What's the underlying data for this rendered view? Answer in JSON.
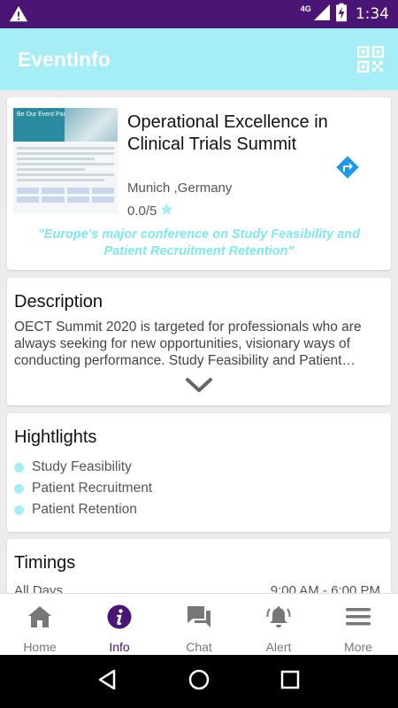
{
  "status_bar": {
    "network": "4G",
    "time": "1:34",
    "icons": [
      "warning-icon",
      "signal-icon",
      "battery-charging-icon"
    ]
  },
  "app_bar": {
    "title": "EventInfo",
    "icon": "qr-code-icon"
  },
  "event": {
    "title": "Operational Excellence in Clinical Trials Summit",
    "location": "Munich ,Germany",
    "rating": "0.0/5",
    "rating_icon": "star-icon",
    "directions_icon": "directions-icon",
    "tagline": "\"Europe's major conference on Study Feasibility and Patient Recruitment Retention\"",
    "thumbnail_text": "Be Our Event Partner"
  },
  "description": {
    "title": "Description",
    "text": "OECT Summit 2020 is targeted for professionals who are always seeking for new opportunities, visionary ways of conducting performance. Study Feasibility and Patient…",
    "expand_icon": "chevron-down-icon"
  },
  "highlights": {
    "title": "Hightlights",
    "items": [
      "Study Feasibility",
      "Patient Recruitment",
      "Patient Retention"
    ]
  },
  "timings": {
    "title": "Timings",
    "label": "All Days",
    "value": "9:00 AM - 6:00 PM"
  },
  "bottom_nav": {
    "items": [
      {
        "label": "Home",
        "icon": "home-icon"
      },
      {
        "label": "Info",
        "icon": "info-icon"
      },
      {
        "label": "Chat",
        "icon": "chat-icon"
      },
      {
        "label": "Alert",
        "icon": "bell-icon"
      },
      {
        "label": "More",
        "icon": "menu-icon"
      }
    ],
    "active": "Info"
  },
  "colors": {
    "status_bar": "#4a1575",
    "app_bar": "#a6eef5",
    "accent": "#4a1575",
    "tagline": "#7ee8f0",
    "directions": "#1e9be8"
  }
}
